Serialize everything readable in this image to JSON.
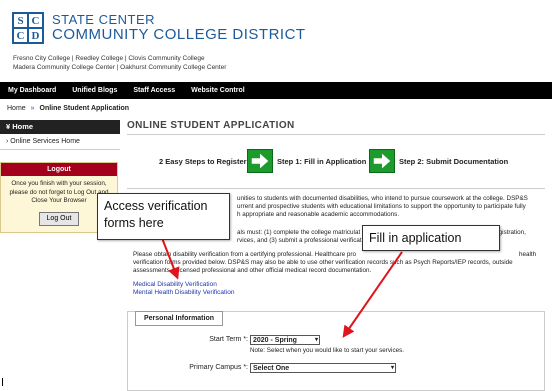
{
  "header": {
    "logo_letters": [
      "S",
      "C",
      "C",
      "D"
    ],
    "title_line1": "STATE CENTER",
    "title_line2": "COMMUNITY COLLEGE DISTRICT",
    "colleges_line1": "Fresno City College  |  Reedley College  |  Clovis Community College",
    "colleges_line2": "Madera Community College Center  |  Oakhurst Community College Center"
  },
  "nav": {
    "items": [
      "My Dashboard",
      "Unified Blogs",
      "Staff Access",
      "Website Control"
    ]
  },
  "breadcrumb": {
    "home": "Home",
    "separator": "»",
    "current": "Online Student Application"
  },
  "sidebar": {
    "home_label": "Home",
    "items": [
      "Online Services Home"
    ],
    "logout": {
      "title": "Logout",
      "text": "Once you finish with your session, please do not forget to Log Out and Close Your Browser",
      "button": "Log Out"
    }
  },
  "main": {
    "title": "ONLINE STUDENT APPLICATION",
    "steps": {
      "intro": "2 Easy Steps to Register",
      "step1": "Step 1: Fill in Application",
      "step2": "Step 2: Submit Documentation"
    },
    "para1_a": "unities to students with documented disabilities, who intend to pursue coursework at the college. DSP&S",
    "para1_b": "urrent and prospective students with educational limitations to support the opportunity to participate fully",
    "para1_c": "h appropriate and reasonable academic accommodations.",
    "para2_a": "als must: (1) complete the college matriculat",
    "para2_b": "rvices, and (3) submit a professional verificati",
    "para2_c": "registration,",
    "para3_a": "Please obtain disability verification from a certifying professional. Healthcare pro",
    "para3_b": "verification forms provided below. DSP&S may also be able to use other verification records such as Psych Reports/IEP records, outside",
    "para3_c": "assessments a licensed professional and other official medical record documentation.",
    "para3_d": "health",
    "link1": "Medical Disability Verification",
    "link2": "Mental Health Disability Verification"
  },
  "personal": {
    "legend": "Personal Information",
    "start_term_label": "Start Term *:",
    "start_term_value": "2020 - Spring",
    "start_term_note": "Note: Select when you would like to start your services.",
    "campus_label": "Primary Campus *:",
    "campus_value": "Select One"
  },
  "callouts": {
    "left": "Access verification forms here",
    "right": "Fill in application"
  },
  "colors": {
    "brand_blue": "#1d5a9b",
    "nav_black": "#000000",
    "logout_red": "#a4001d",
    "arrow_green": "#1c9b2c",
    "annotation_red": "#e0141c"
  }
}
